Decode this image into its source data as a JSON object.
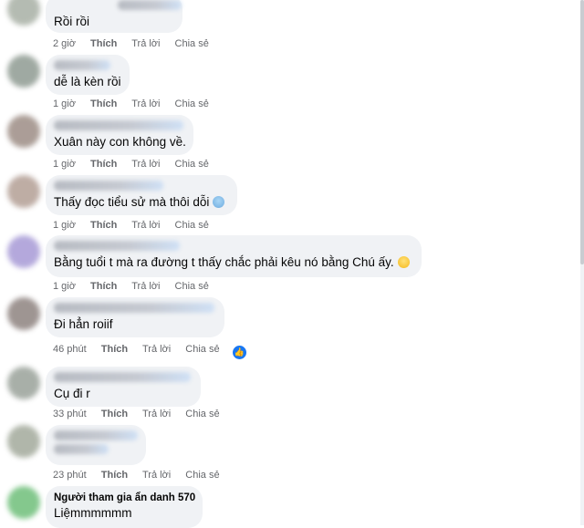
{
  "colors": {
    "bubble": "#f0f2f5",
    "meta_text": "#65676b",
    "like_blue": "#1877f2"
  },
  "actions": {
    "like": "Thích",
    "reply": "Trả lời",
    "share": "Chia sẻ"
  },
  "comments": [
    {
      "text": "Rồi rồi",
      "time": "2 giờ"
    },
    {
      "text": "dễ là kèn rồi",
      "time": "1 giờ"
    },
    {
      "text": "Xuân này con không về.",
      "time": "1 giờ"
    },
    {
      "text": "Thấy đọc tiểu sử mà thôi dỗi",
      "time": "1 giờ",
      "emoji": "cold-sweat-face-icon"
    },
    {
      "text": "Bằng tuổi t mà ra đường t thấy chắc phải kêu nó bằng Chú ấy.",
      "time": "1 giờ",
      "emoji": "grinning-sweat-face-icon"
    },
    {
      "text": "Đi hẳn roiif",
      "time": "46 phút",
      "reaction": "like-reaction-icon"
    },
    {
      "text": "Cụ đi r",
      "time": "33 phút"
    },
    {
      "text": "",
      "time": "23 phút"
    },
    {
      "author": "Người tham gia ẩn danh 570",
      "text": "Liệmmmmmm"
    }
  ]
}
